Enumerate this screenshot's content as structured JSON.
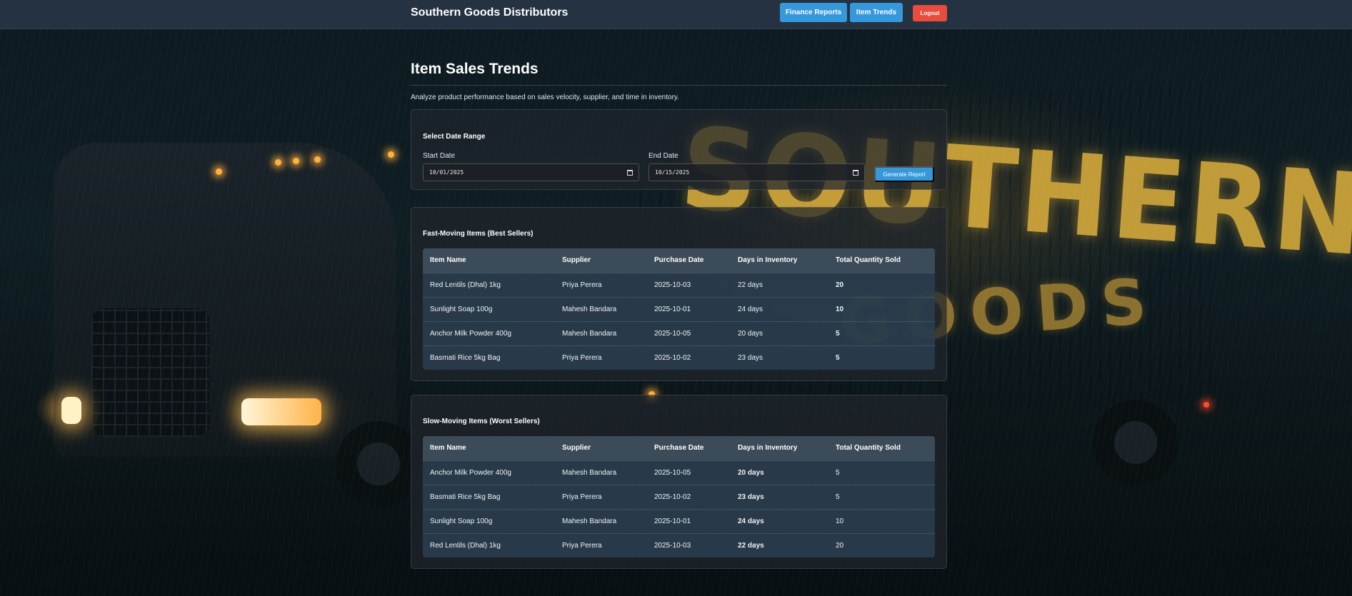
{
  "navbar": {
    "brand": "Southern Goods Distributors",
    "finance_reports": "Finance Reports",
    "item_trends": "Item Trends",
    "logout": "Logout"
  },
  "background": {
    "headline": "SOUTHERN",
    "subline": "GOODS"
  },
  "page": {
    "title": "Item Sales Trends",
    "description": "Analyze product performance based on sales velocity, supplier, and time in inventory."
  },
  "date_range": {
    "title": "Select Date Range",
    "start_label": "Start Date",
    "start_value": "10/01/2025",
    "end_label": "End Date",
    "end_value": "10/15/2025",
    "generate_button": "Generate Report"
  },
  "columns": {
    "item_name": "Item Name",
    "supplier": "Supplier",
    "purchase_date": "Purchase Date",
    "days_in_inventory": "Days in Inventory",
    "total_quantity_sold": "Total Quantity Sold"
  },
  "fast_moving": {
    "title": "Fast-Moving Items (Best Sellers)",
    "rows": [
      {
        "item": "Red Lentils (Dhal) 1kg",
        "supplier": "Priya Perera",
        "date": "2025-10-03",
        "days": "22 days",
        "qty": "20"
      },
      {
        "item": "Sunlight Soap 100g",
        "supplier": "Mahesh Bandara",
        "date": "2025-10-01",
        "days": "24 days",
        "qty": "10"
      },
      {
        "item": "Anchor Milk Powder 400g",
        "supplier": "Mahesh Bandara",
        "date": "2025-10-05",
        "days": "20 days",
        "qty": "5"
      },
      {
        "item": "Basmati Rice 5kg Bag",
        "supplier": "Priya Perera",
        "date": "2025-10-02",
        "days": "23 days",
        "qty": "5"
      }
    ]
  },
  "slow_moving": {
    "title": "Slow-Moving Items (Worst Sellers)",
    "rows": [
      {
        "item": "Anchor Milk Powder 400g",
        "supplier": "Mahesh Bandara",
        "date": "2025-10-05",
        "days": "20 days",
        "qty": "5"
      },
      {
        "item": "Basmati Rice 5kg Bag",
        "supplier": "Priya Perera",
        "date": "2025-10-02",
        "days": "23 days",
        "qty": "5"
      },
      {
        "item": "Sunlight Soap 100g",
        "supplier": "Mahesh Bandara",
        "date": "2025-10-01",
        "days": "24 days",
        "qty": "10"
      },
      {
        "item": "Red Lentils (Dhal) 1kg",
        "supplier": "Priya Perera",
        "date": "2025-10-03",
        "days": "22 days",
        "qty": "20"
      }
    ]
  },
  "colors": {
    "primary": "#3498db",
    "danger": "#e74c3c",
    "navbar": "#263442"
  }
}
